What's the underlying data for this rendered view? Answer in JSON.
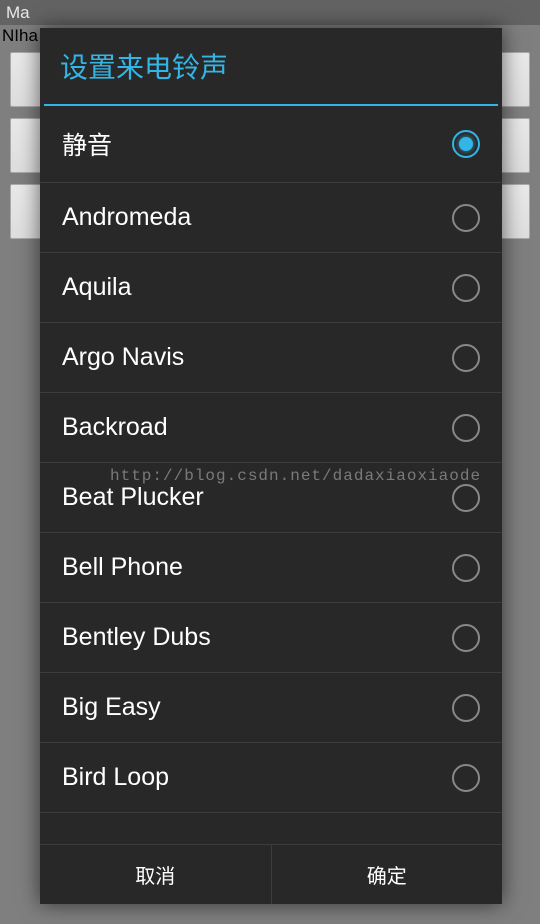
{
  "activity": {
    "title": "Ma",
    "bg_text": "NIha"
  },
  "dialog": {
    "title": "设置来电铃声",
    "ringtones": [
      {
        "label": "静音",
        "selected": true
      },
      {
        "label": "Andromeda",
        "selected": false
      },
      {
        "label": "Aquila",
        "selected": false
      },
      {
        "label": "Argo Navis",
        "selected": false
      },
      {
        "label": "Backroad",
        "selected": false
      },
      {
        "label": "Beat Plucker",
        "selected": false
      },
      {
        "label": "Bell Phone",
        "selected": false
      },
      {
        "label": "Bentley Dubs",
        "selected": false
      },
      {
        "label": "Big Easy",
        "selected": false
      },
      {
        "label": "Bird Loop",
        "selected": false
      }
    ],
    "cancel_label": "取消",
    "ok_label": "确定"
  },
  "watermark": "http://blog.csdn.net/dadaxiaoxiaode"
}
